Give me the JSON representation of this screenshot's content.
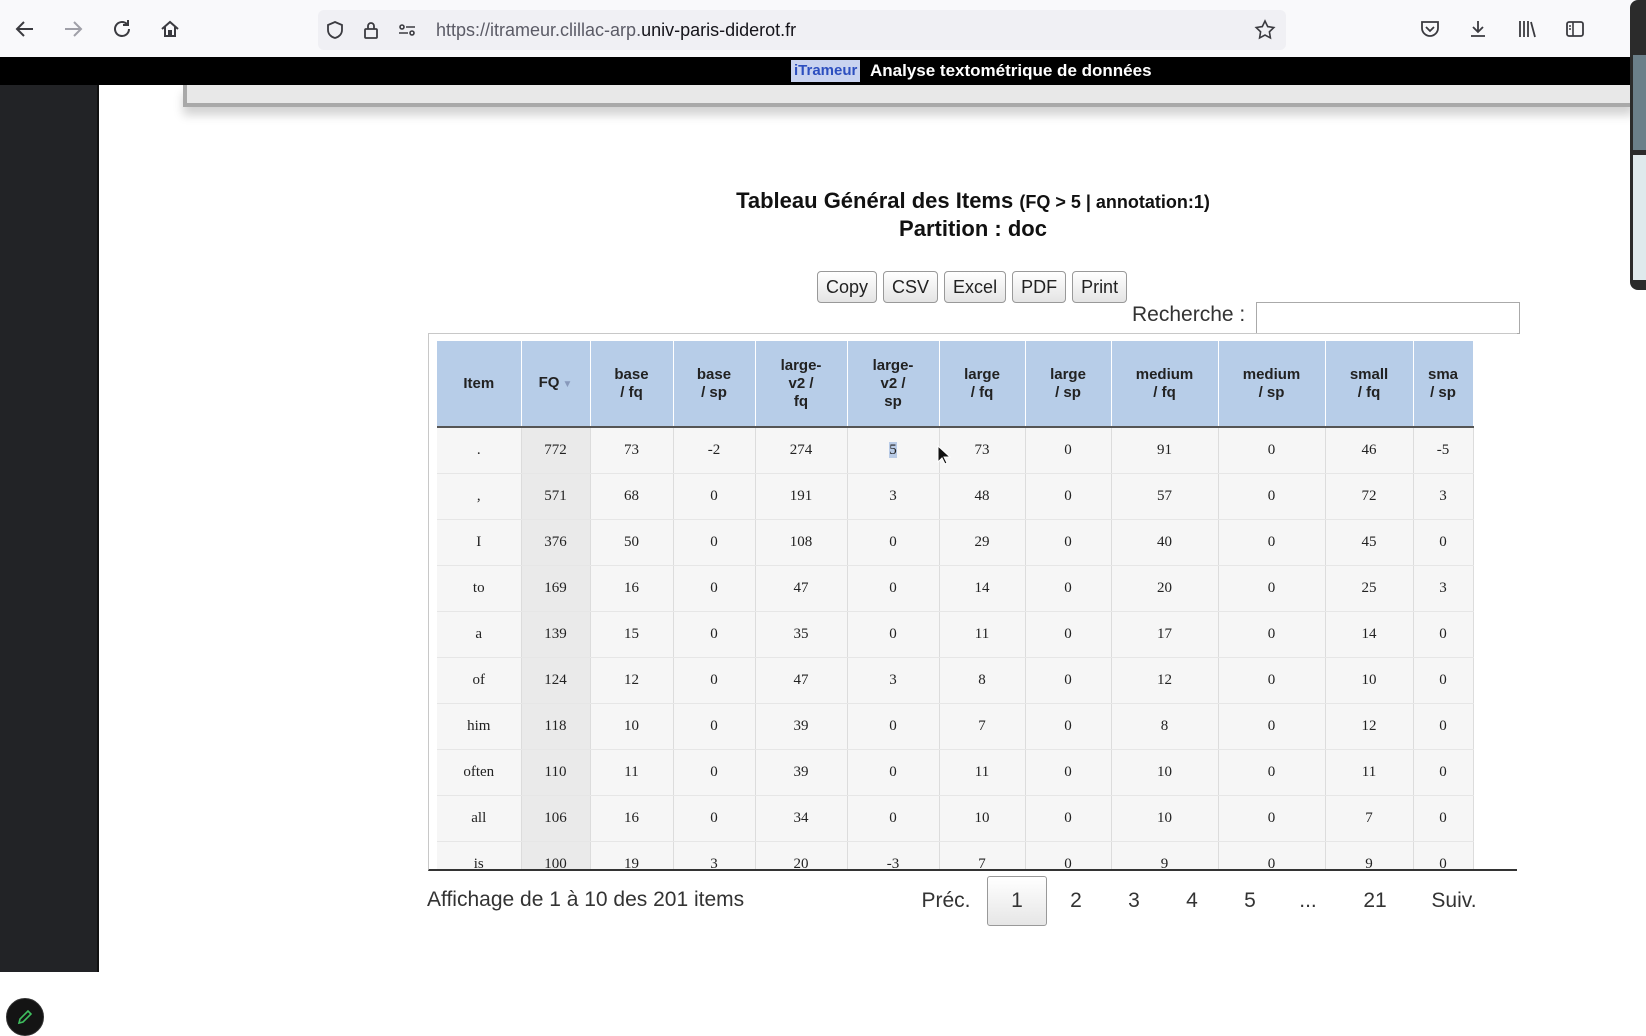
{
  "browser": {
    "url_prefix": "https://itrameur.clillac-arp.",
    "url_host": "univ-paris-diderot.fr"
  },
  "banner": {
    "logo": "iTrameur",
    "title": "Analyse textométrique de données"
  },
  "page": {
    "title_main": "Tableau Général des Items",
    "title_sub": "(FQ > 5 | annotation:1)",
    "partition": "Partition : doc",
    "export_buttons": [
      "Copy",
      "CSV",
      "Excel",
      "PDF",
      "Print"
    ],
    "search_label": "Recherche :",
    "search_value": ""
  },
  "table": {
    "headers": [
      [
        "Item"
      ],
      [
        "FQ"
      ],
      [
        "base",
        "/ fq"
      ],
      [
        "base",
        "/ sp"
      ],
      [
        "large-",
        "v2 /",
        "fq"
      ],
      [
        "large-",
        "v2 /",
        "sp"
      ],
      [
        "large",
        "/ fq"
      ],
      [
        "large",
        "/ sp"
      ],
      [
        "medium",
        "/ fq"
      ],
      [
        "medium",
        "/ sp"
      ],
      [
        "small",
        "/ fq"
      ],
      [
        "sma",
        "/ sp"
      ]
    ],
    "sorted_column": "FQ",
    "rows": [
      [
        ".",
        "772",
        "73",
        "-2",
        "274",
        "5",
        "73",
        "0",
        "91",
        "0",
        "46",
        "-5"
      ],
      [
        ",",
        "571",
        "68",
        "0",
        "191",
        "3",
        "48",
        "0",
        "57",
        "0",
        "72",
        "3"
      ],
      [
        "I",
        "376",
        "50",
        "0",
        "108",
        "0",
        "29",
        "0",
        "40",
        "0",
        "45",
        "0"
      ],
      [
        "to",
        "169",
        "16",
        "0",
        "47",
        "0",
        "14",
        "0",
        "20",
        "0",
        "25",
        "3"
      ],
      [
        "a",
        "139",
        "15",
        "0",
        "35",
        "0",
        "11",
        "0",
        "17",
        "0",
        "14",
        "0"
      ],
      [
        "of",
        "124",
        "12",
        "0",
        "47",
        "3",
        "8",
        "0",
        "12",
        "0",
        "10",
        "0"
      ],
      [
        "him",
        "118",
        "10",
        "0",
        "39",
        "0",
        "7",
        "0",
        "8",
        "0",
        "12",
        "0"
      ],
      [
        "often",
        "110",
        "11",
        "0",
        "39",
        "0",
        "11",
        "0",
        "10",
        "0",
        "11",
        "0"
      ],
      [
        "all",
        "106",
        "16",
        "0",
        "34",
        "0",
        "10",
        "0",
        "10",
        "0",
        "7",
        "0"
      ],
      [
        "is",
        "100",
        "19",
        "3",
        "20",
        "-3",
        "7",
        "0",
        "9",
        "0",
        "9",
        "0"
      ]
    ]
  },
  "footer": {
    "info": "Affichage de 1 à 10 des 201 items",
    "prev": "Préc.",
    "pages": [
      "1",
      "2",
      "3",
      "4",
      "5",
      "...",
      "21"
    ],
    "current_page": "1",
    "next": "Suiv."
  }
}
